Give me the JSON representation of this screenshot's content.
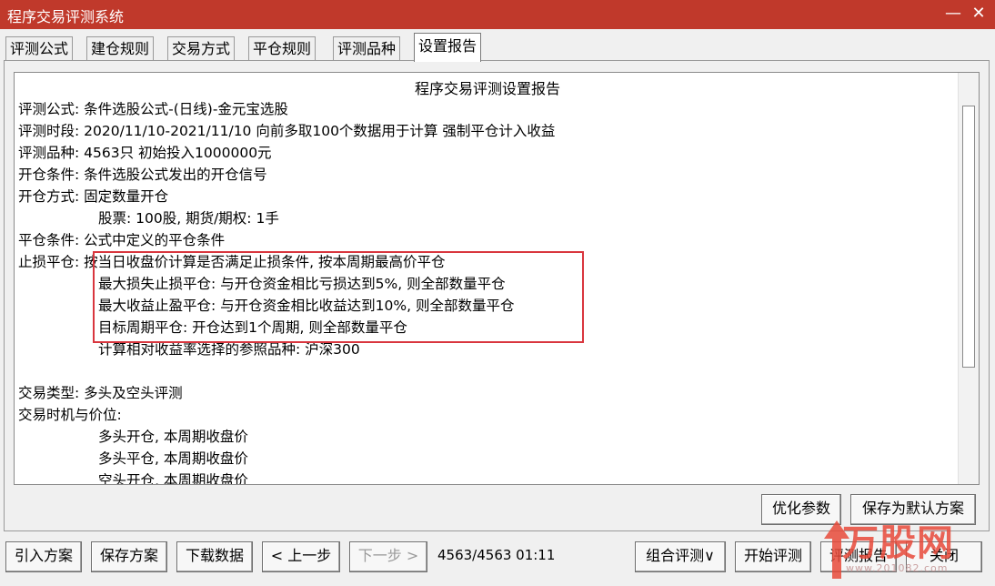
{
  "window": {
    "title": "程序交易评测系统",
    "minimize": "—",
    "close": "✕"
  },
  "tabs": [
    {
      "label": "评测公式"
    },
    {
      "label": "建仓规则"
    },
    {
      "label": "交易方式"
    },
    {
      "label": "平仓规则"
    },
    {
      "label": "评测品种"
    },
    {
      "label": "设置报告"
    }
  ],
  "report": {
    "title": "程序交易评测设置报告",
    "lines": [
      "评测公式: 条件选股公式-(日线)-金元宝选股",
      "评测时段: 2020/11/10-2021/11/10 向前多取100个数据用于计算 强制平仓计入收益",
      "评测品种: 4563只 初始投入1000000元",
      "开仓条件: 条件选股公式发出的开仓信号",
      "开仓方式: 固定数量开仓",
      "股票: 100股, 期货/期权: 1手",
      "平仓条件: 公式中定义的平仓条件",
      "止损平仓: 按当日收盘价计算是否满足止损条件, 按本周期最高价平仓",
      "最大损失止损平仓: 与开仓资金相比亏损达到5%, 则全部数量平仓",
      "最大收益止盈平仓: 与开仓资金相比收益达到10%, 则全部数量平仓",
      "目标周期平仓: 开仓达到1个周期, 则全部数量平仓",
      "计算相对收益率选择的参照品种: 沪深300",
      "交易类型: 多头及空头评测",
      "交易时机与价位:",
      "多头开仓, 本周期收盘价",
      "多头平仓, 本周期收盘价",
      "空头开仓, 本周期收盘价"
    ]
  },
  "buttons": {
    "optimize": "优化参数",
    "save_default": "保存为默认方案",
    "import": "引入方案",
    "save_plan": "保存方案",
    "download": "下载数据",
    "prev": "< 上一步",
    "next": "下一步 >",
    "combo": "组合评测∨",
    "start": "开始评测",
    "eval_report": "评测报告",
    "close": "关闭"
  },
  "status": "4563/4563  01:11",
  "watermark": {
    "text": "万股网",
    "url": "www.201082.com"
  },
  "colors": {
    "titlebar": "#c0392b",
    "highlight": "#d9363e"
  }
}
